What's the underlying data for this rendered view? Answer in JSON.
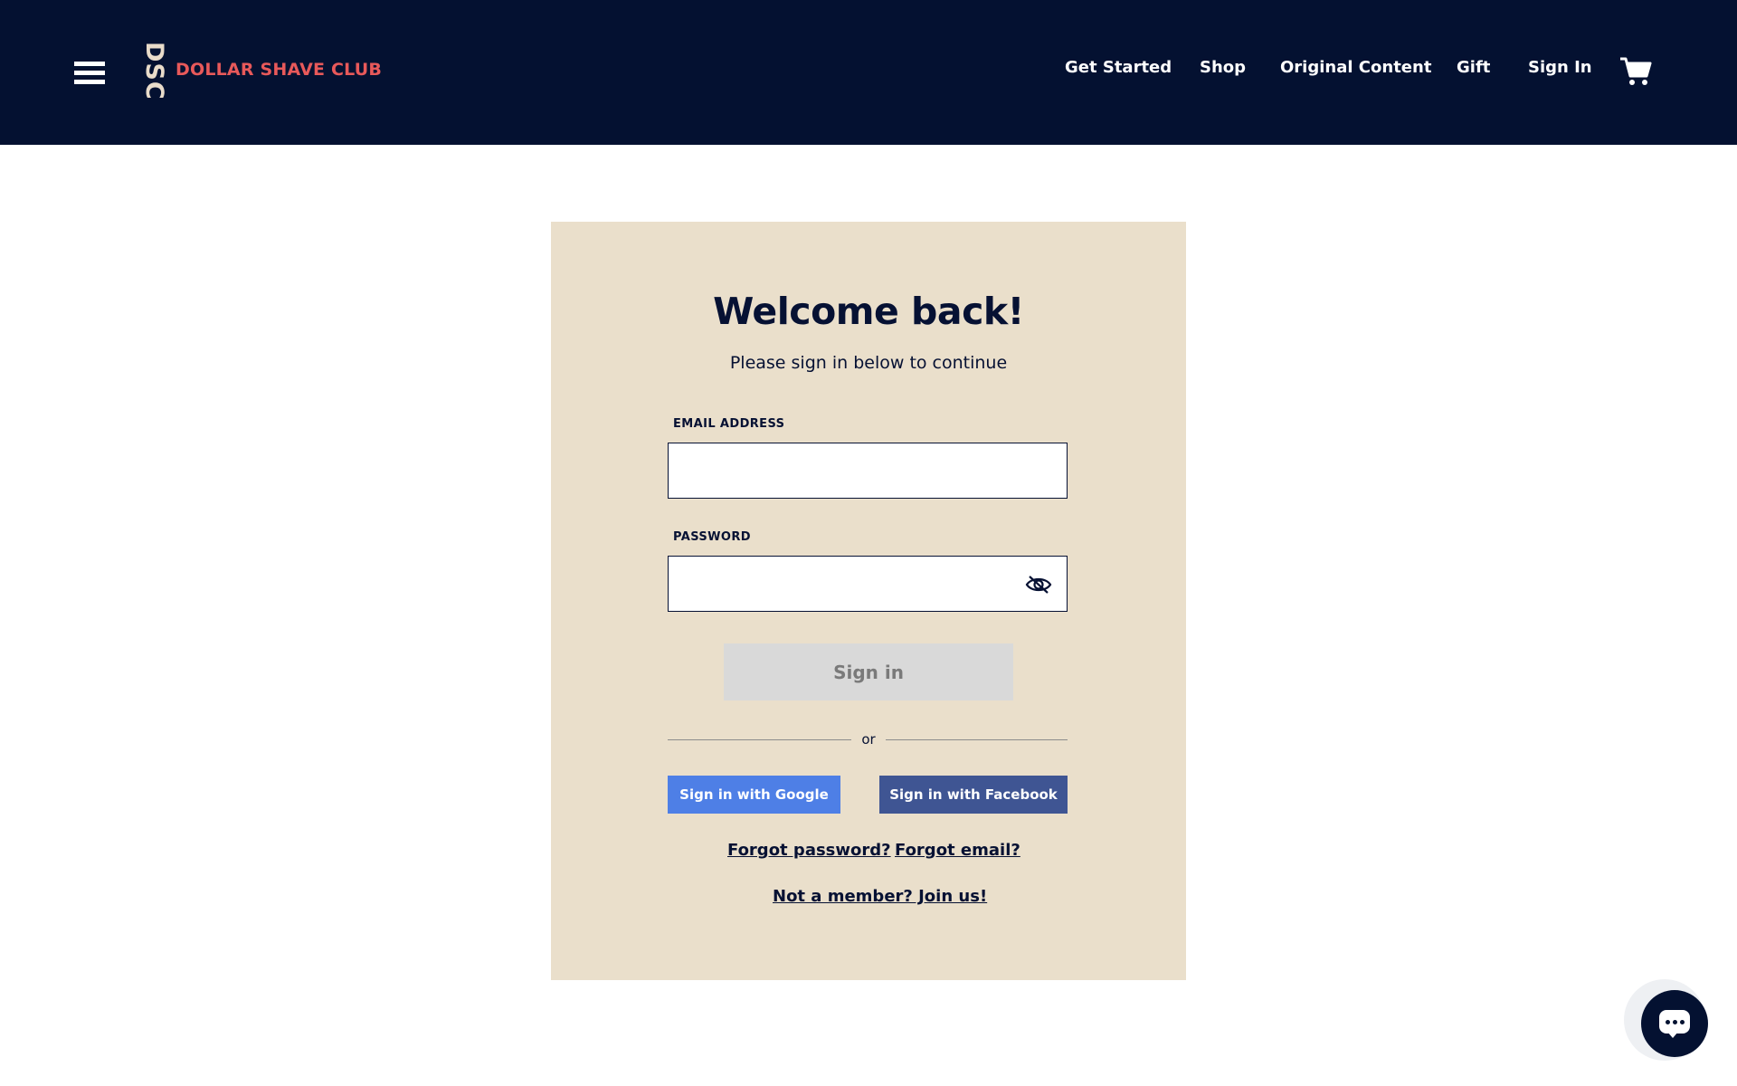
{
  "header": {
    "logo_mark": "DSC",
    "logo_text": "DOLLAR SHAVE CLUB",
    "nav": [
      "Get Started",
      "Shop",
      "Original Content",
      "Gift",
      "Sign In"
    ]
  },
  "signin": {
    "title": "Welcome back!",
    "subtitle": "Please sign in below to continue",
    "email_label": "EMAIL ADDRESS",
    "email_value": "",
    "password_label": "PASSWORD",
    "password_value": "",
    "submit_label": "Sign in",
    "divider_text": "or",
    "google_label": "Sign in with Google",
    "facebook_label": "Sign in with Facebook",
    "forgot_password": "Forgot password?",
    "forgot_email": "Forgot email?",
    "join": "Not a member? Join us!"
  },
  "icons": {
    "menu": "hamburger-icon",
    "cart": "cart-icon",
    "password_toggle": "eye-slash-icon",
    "chat": "chat-icon"
  },
  "colors": {
    "header_bg": "#041131",
    "brand": "#e8595a",
    "card_bg": "#eadfcb",
    "google": "#4e7fe6",
    "facebook": "#3f5593",
    "disabled_button": "#d9d9d9"
  }
}
